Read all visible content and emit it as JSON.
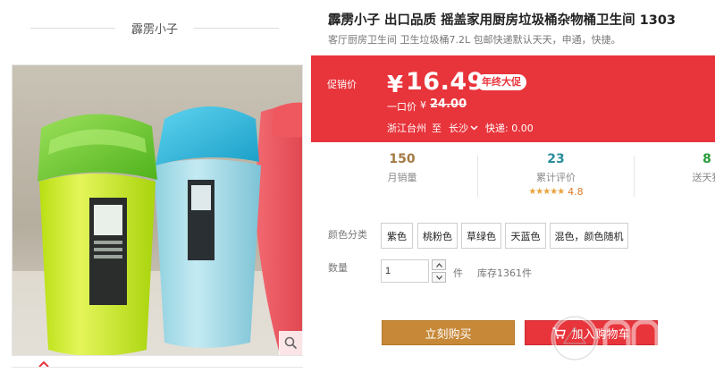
{
  "shop": {
    "name": "霹雳小子"
  },
  "product": {
    "title": "霹雳小子 出口品质 摇盖家用厨房垃圾桶杂物桶卫生间 1303",
    "subtitle": "客厅厨房卫生间 卫生垃圾桶7.2L 包邮快递默认天天，申通，快捷。"
  },
  "price": {
    "promo_label": "促销价",
    "currency": "¥",
    "promo_value": "16.49",
    "badge": "年终大促",
    "original_label": "一口价",
    "original_currency": "¥",
    "original_value": "24.00"
  },
  "shipping": {
    "from": "浙江台州",
    "to_label": "至",
    "destination": "长沙",
    "fee": "快递: 0.00"
  },
  "stats": {
    "monthly_sales_value": "150",
    "monthly_sales_label": "月销量",
    "reviews_value": "23",
    "reviews_label": "累计评价",
    "rating_stars": "★★★★★",
    "rating_value": "4.8",
    "third_value": "8",
    "third_label": "送天猫"
  },
  "options": {
    "color_label": "颜色分类",
    "colors": [
      "紫色",
      "桃粉色",
      "草绿色",
      "天蓝色",
      "混色，颜色随机"
    ]
  },
  "quantity": {
    "label": "数量",
    "value": "1",
    "unit": "件",
    "stock": "库存1361件"
  },
  "actions": {
    "buy_now": "立刻购买",
    "add_to_cart": "加入购物车"
  },
  "colors": {
    "price_panel": "#e8343b",
    "buy_now": "#c78838",
    "add_to_cart": "#e8343b"
  },
  "icons": {
    "zoom": "magnifier-icon",
    "prev": "chevron-up-icon",
    "cart": "cart-icon"
  }
}
